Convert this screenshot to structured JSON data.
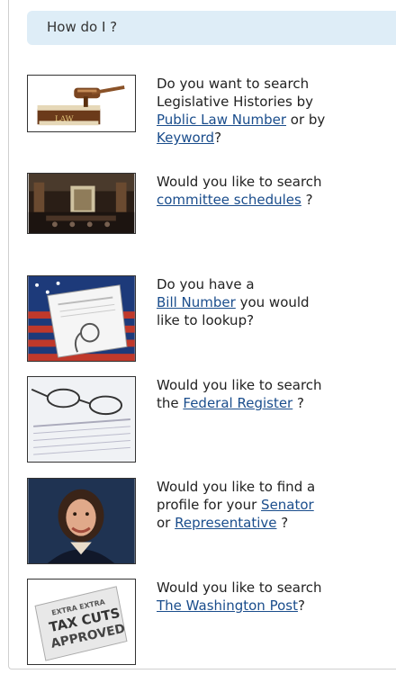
{
  "header": {
    "title": "How do I ?"
  },
  "items": [
    {
      "line1": "Do you want to search",
      "line2": "Legislative Histories by",
      "link1": "Public Law Number",
      "mid": " or by",
      "link2": "Keyword",
      "end": "?",
      "image_label": "LAW"
    },
    {
      "pre": "Would you like to search",
      "link": "committee schedules",
      "end": " ?"
    },
    {
      "line1": "Do you have a",
      "link": "Bill Number",
      "after": " you would",
      "line3": "like to lookup?"
    },
    {
      "pre": "Would you like to search",
      "lead": "the ",
      "link": "Federal Register",
      "end": " ?"
    },
    {
      "pre": "Would you like to find a",
      "line2": "profile for your ",
      "link1": "Senator",
      "lead3": "or ",
      "link2": "Representative",
      "end": " ?"
    },
    {
      "pre": "Would you like to search",
      "link": "The Washington Post",
      "end": "?",
      "image_lines": [
        "EXTRA EXTRA",
        "TAX CUTS",
        "APPROVED"
      ]
    }
  ]
}
